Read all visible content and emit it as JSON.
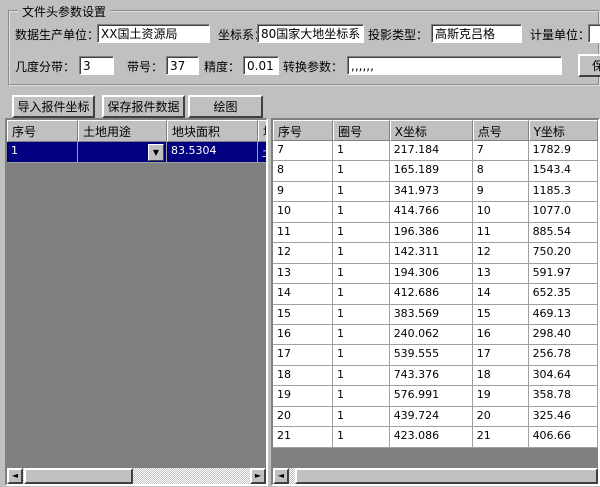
{
  "header_panel": {
    "title": "文件头参数设置",
    "fields_row1": [
      {
        "label": "数据生产单位：",
        "value": "XX国土资源局"
      },
      {
        "label": "坐标系：",
        "value": "80国家大地坐标系"
      },
      {
        "label": "投影类型：",
        "value": "高斯克吕格"
      },
      {
        "label": "计量单位：",
        "value": ""
      }
    ],
    "fields_row2": [
      {
        "label": "几度分带：",
        "value": "3"
      },
      {
        "label": "带号：",
        "value": "37"
      },
      {
        "label": "精度：",
        "value": "0.01"
      },
      {
        "label": "转换参数：",
        "value": ",,,,,,"
      }
    ],
    "save_button_label": "保"
  },
  "toolbar": {
    "import_button": "导入报件坐标",
    "save_button": "保存报件数据",
    "draw_button": "绘图"
  },
  "left_table": {
    "columns": [
      "序号",
      "土地用途",
      "地块面积"
    ],
    "partial_column_header": "地",
    "rows": [
      {
        "seq": "1",
        "land_use": "",
        "area": "83.5304",
        "partial": "土"
      }
    ]
  },
  "right_table": {
    "columns": [
      "序号",
      "圈号",
      "X坐标",
      "点号",
      "Y坐标"
    ],
    "rows": [
      [
        "7",
        "1",
        "217.184",
        "7",
        "1782.9"
      ],
      [
        "8",
        "1",
        "165.189",
        "8",
        "1543.4"
      ],
      [
        "9",
        "1",
        "341.973",
        "9",
        "1185.3"
      ],
      [
        "10",
        "1",
        "414.766",
        "10",
        "1077.0"
      ],
      [
        "11",
        "1",
        "196.386",
        "11",
        "885.54"
      ],
      [
        "12",
        "1",
        "142.311",
        "12",
        "750.20"
      ],
      [
        "13",
        "1",
        "194.306",
        "13",
        "591.97"
      ],
      [
        "14",
        "1",
        "412.686",
        "14",
        "652.35"
      ],
      [
        "15",
        "1",
        "383.569",
        "15",
        "469.13"
      ],
      [
        "16",
        "1",
        "240.062",
        "16",
        "298.40"
      ],
      [
        "17",
        "1",
        "539.555",
        "17",
        "256.78"
      ],
      [
        "18",
        "1",
        "743.376",
        "18",
        "304.64"
      ],
      [
        "19",
        "1",
        "576.991",
        "19",
        "358.78"
      ],
      [
        "20",
        "1",
        "439.724",
        "20",
        "325.46"
      ],
      [
        "21",
        "1",
        "423.086",
        "21",
        "406.66"
      ]
    ]
  },
  "icons": {
    "dropdown": "▼",
    "scroll_left": "◄",
    "scroll_right": "►"
  },
  "colors": {
    "window_bg": "#c0c0c0",
    "selection_bg": "#000080",
    "selection_text": "#ffffff",
    "grid_empty_bg": "#808080",
    "cell_bg": "#ffffff"
  }
}
